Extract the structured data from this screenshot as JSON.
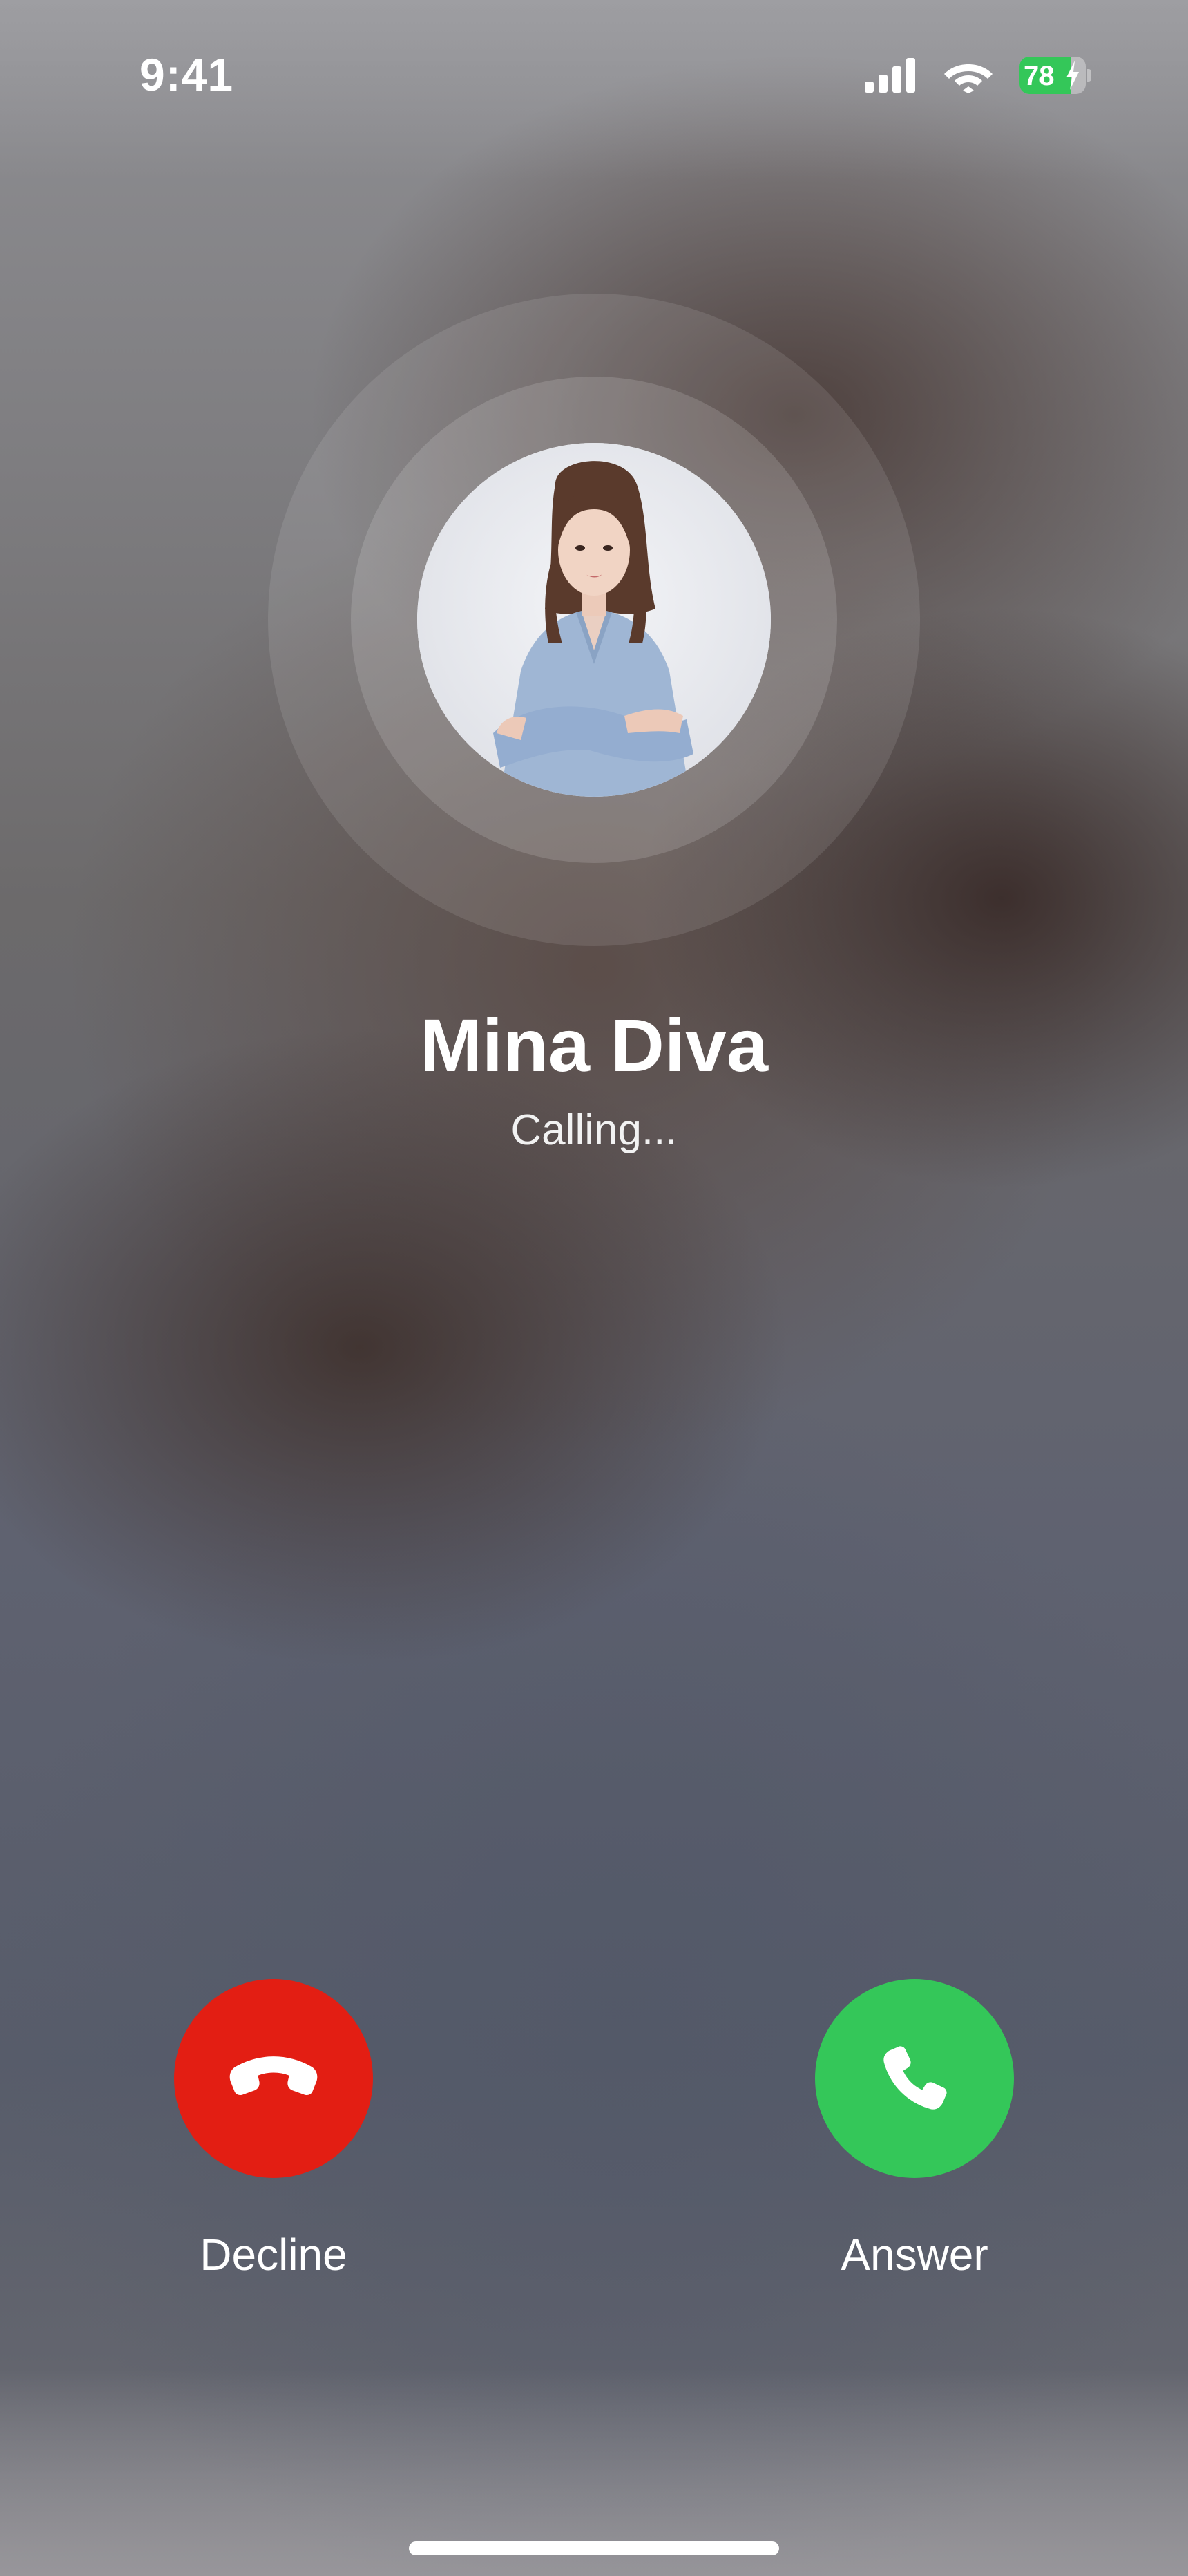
{
  "status_bar": {
    "time": "9:41",
    "battery_level": "78",
    "battery_charging": true,
    "battery_fraction": 0.78,
    "icons": [
      "cellular-signal-icon",
      "wifi-icon",
      "battery-icon"
    ]
  },
  "caller": {
    "name": "Mina Diva",
    "status": "Calling..."
  },
  "actions": {
    "decline_label": "Decline",
    "answer_label": "Answer",
    "decline_color": "#e31e13",
    "answer_color": "#34c759"
  }
}
